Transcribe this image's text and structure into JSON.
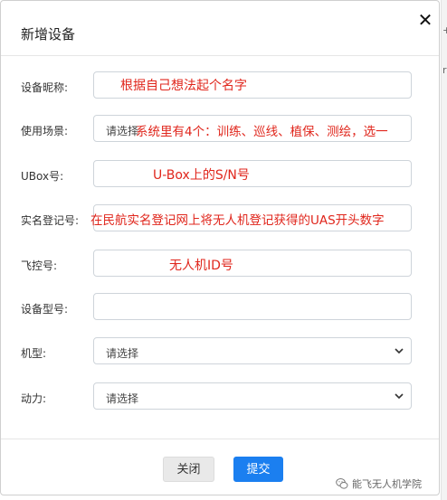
{
  "dialog": {
    "title": "新增设备",
    "close_glyph": "✕"
  },
  "form": {
    "fields": [
      {
        "label": "设备昵称:",
        "annotation": "根据自己想法起个名字"
      },
      {
        "label": "使用场景:",
        "placeholder": "请选择",
        "annotation": "系统里有4个：训练、巡线、植保、测绘，选一"
      },
      {
        "label": "UBox号:",
        "annotation": "U-Box上的S/N号"
      },
      {
        "label": "实名登记号:",
        "annotation": "在民航实名登记网上将无人机登记获得的UAS开头数字"
      },
      {
        "label": "飞控号:",
        "annotation": "无人机ID号"
      },
      {
        "label": "设备型号:"
      },
      {
        "label": "机型:",
        "placeholder": "请选择"
      },
      {
        "label": "动力:",
        "placeholder": "请选择"
      }
    ]
  },
  "footer": {
    "close_label": "关闭",
    "submit_label": "提交"
  },
  "watermark": {
    "text": "能飞无人机学院",
    "icon": "wechat-icon"
  },
  "colors": {
    "annotation": "#e0261c",
    "primary": "#1b7ff0"
  }
}
